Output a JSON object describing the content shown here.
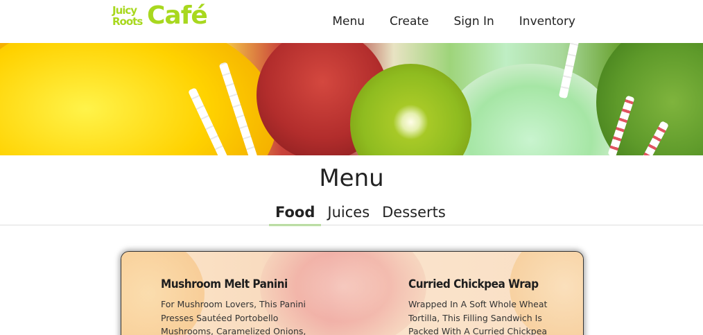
{
  "brand": {
    "logo_small_top": "Juicy",
    "logo_small_bottom": "Roots",
    "logo_big": "Café",
    "accent_color": "#a8d81f"
  },
  "nav": {
    "items": [
      {
        "label": "Menu"
      },
      {
        "label": "Create"
      },
      {
        "label": "Sign In"
      },
      {
        "label": "Inventory"
      }
    ]
  },
  "hero": {
    "image": "fruit-and-juice-banner"
  },
  "menu": {
    "title": "Menu",
    "tabs": [
      {
        "label": "Food",
        "active": true
      },
      {
        "label": "Juices",
        "active": false
      },
      {
        "label": "Desserts",
        "active": false
      }
    ],
    "tab_underline_color": "#a3dc7d",
    "items": [
      {
        "name": "Mushroom Melt Panini",
        "description": "For Mushroom Lovers, This Panini Presses Sautéed Portobello Mushrooms, Caramelized Onions,"
      },
      {
        "name": "Curried Chickpea Wrap",
        "description": "Wrapped In A Soft Whole Wheat Tortilla, This Filling Sandwich Is Packed With A Curried Chickpea"
      }
    ]
  }
}
